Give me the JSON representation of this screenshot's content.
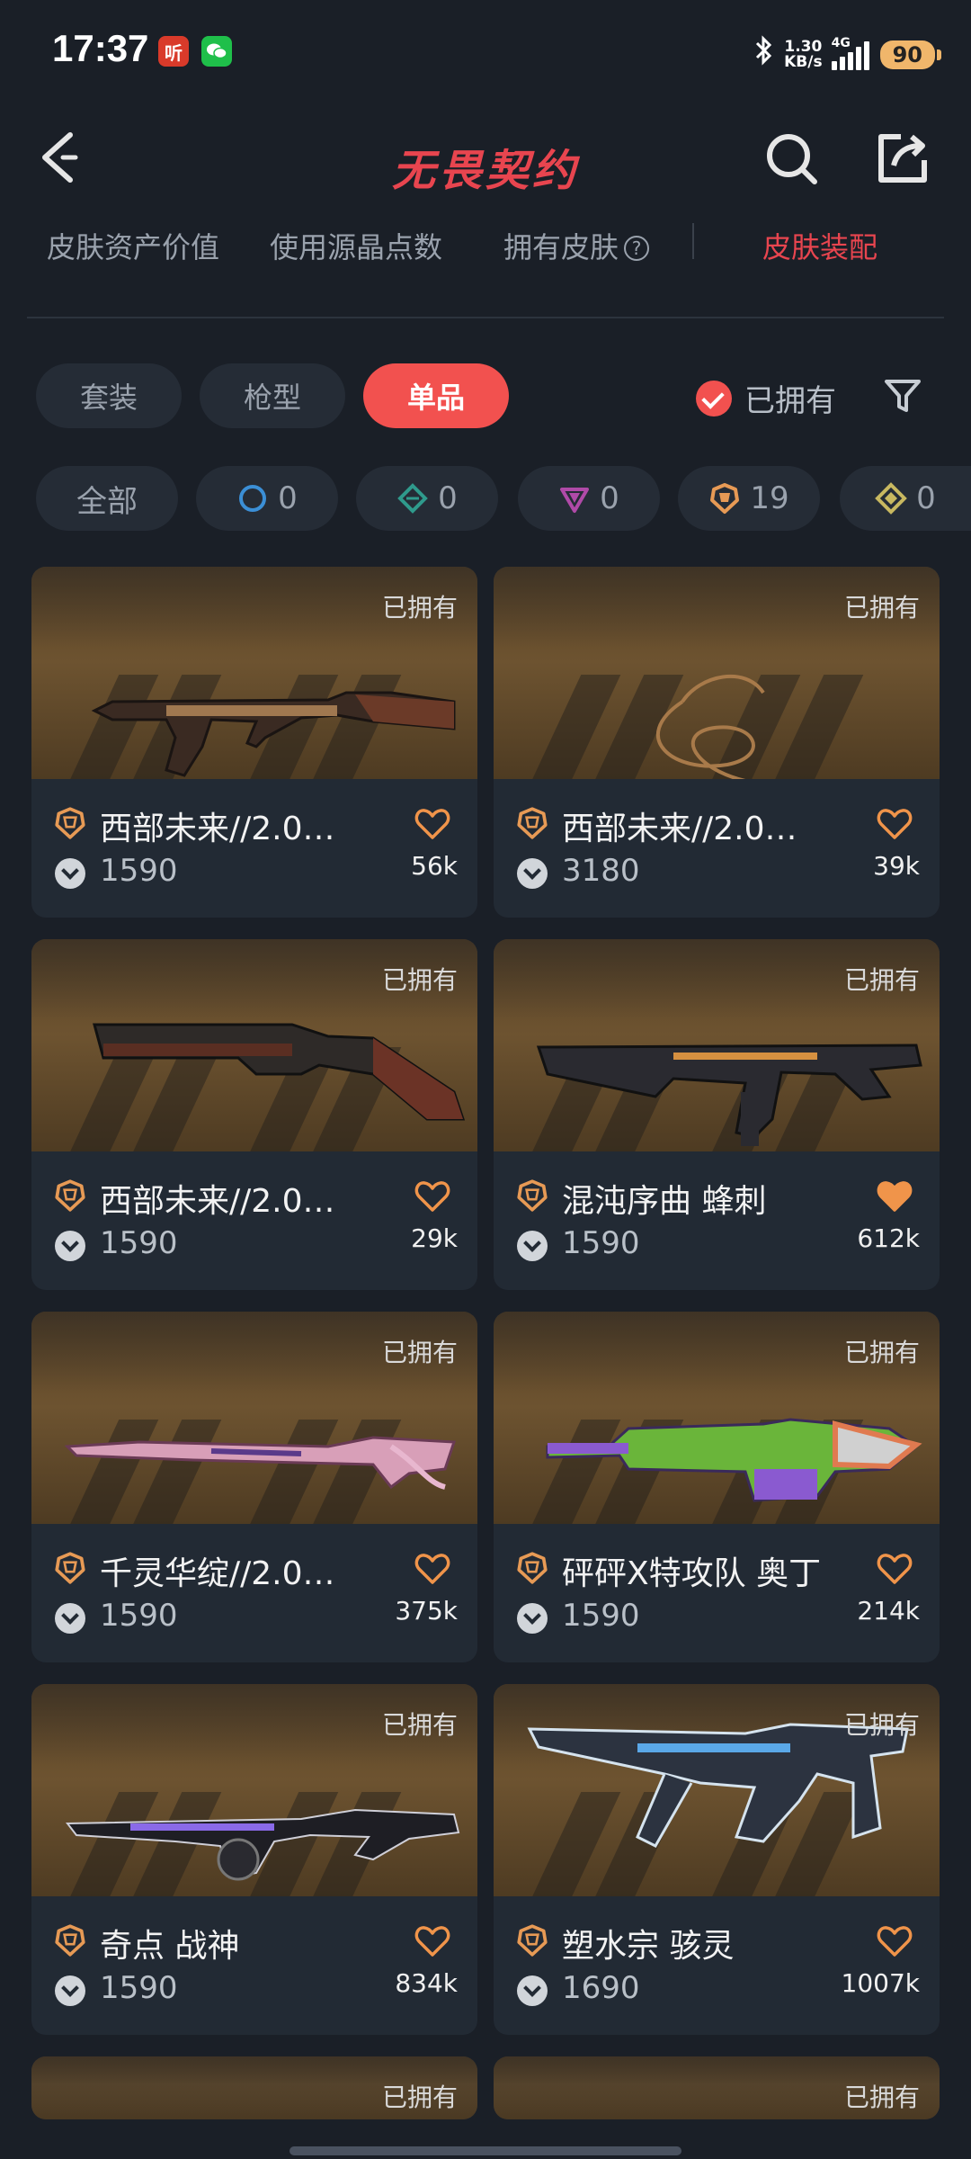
{
  "status": {
    "time": "17:37",
    "app1": "听",
    "app2": "微",
    "speed_value": "1.30",
    "speed_unit": "KB/s",
    "network": "4G",
    "battery": "90"
  },
  "header": {
    "title": "无畏契约"
  },
  "tabs": [
    {
      "label": "皮肤资产价值"
    },
    {
      "label": "使用源晶点数"
    },
    {
      "label": "拥有皮肤"
    },
    {
      "label": "皮肤装配"
    }
  ],
  "filters": {
    "categories": [
      "套装",
      "枪型",
      "单品"
    ],
    "owned_label": "已拥有"
  },
  "tiers": [
    {
      "label": "全部"
    },
    {
      "count": "0",
      "icon": "select-tier-icon",
      "color": "#3b8fd6"
    },
    {
      "count": "0",
      "icon": "deluxe-tier-icon",
      "color": "#2f9a8c"
    },
    {
      "count": "0",
      "icon": "premium-tier-icon",
      "color": "#b04aa8"
    },
    {
      "count": "19",
      "icon": "exclusive-tier-icon",
      "color": "#e79a55"
    },
    {
      "count": "0",
      "icon": "ultra-tier-icon",
      "color": "#c8b860"
    }
  ],
  "owned_tag": "已拥有",
  "skins": [
    {
      "name": "西部未来//2.0…",
      "price": "1590",
      "likes": "56k",
      "liked": false
    },
    {
      "name": "西部未来//2.0…",
      "price": "3180",
      "likes": "39k",
      "liked": false
    },
    {
      "name": "西部未来//2.0…",
      "price": "1590",
      "likes": "29k",
      "liked": false
    },
    {
      "name": "混沌序曲 蜂刺",
      "price": "1590",
      "likes": "612k",
      "liked": true
    },
    {
      "name": "千灵华绽//2.0…",
      "price": "1590",
      "likes": "375k",
      "liked": false
    },
    {
      "name": "砰砰X特攻队 奥丁",
      "price": "1590",
      "likes": "214k",
      "liked": false
    },
    {
      "name": "奇点 战神",
      "price": "1590",
      "likes": "834k",
      "liked": false
    },
    {
      "name": "塑水宗 骇灵",
      "price": "1690",
      "likes": "1007k",
      "liked": false
    }
  ],
  "colors": {
    "accent": "#f2514f",
    "tier_exclusive": "#e79a55",
    "heart": "#f0944a"
  }
}
